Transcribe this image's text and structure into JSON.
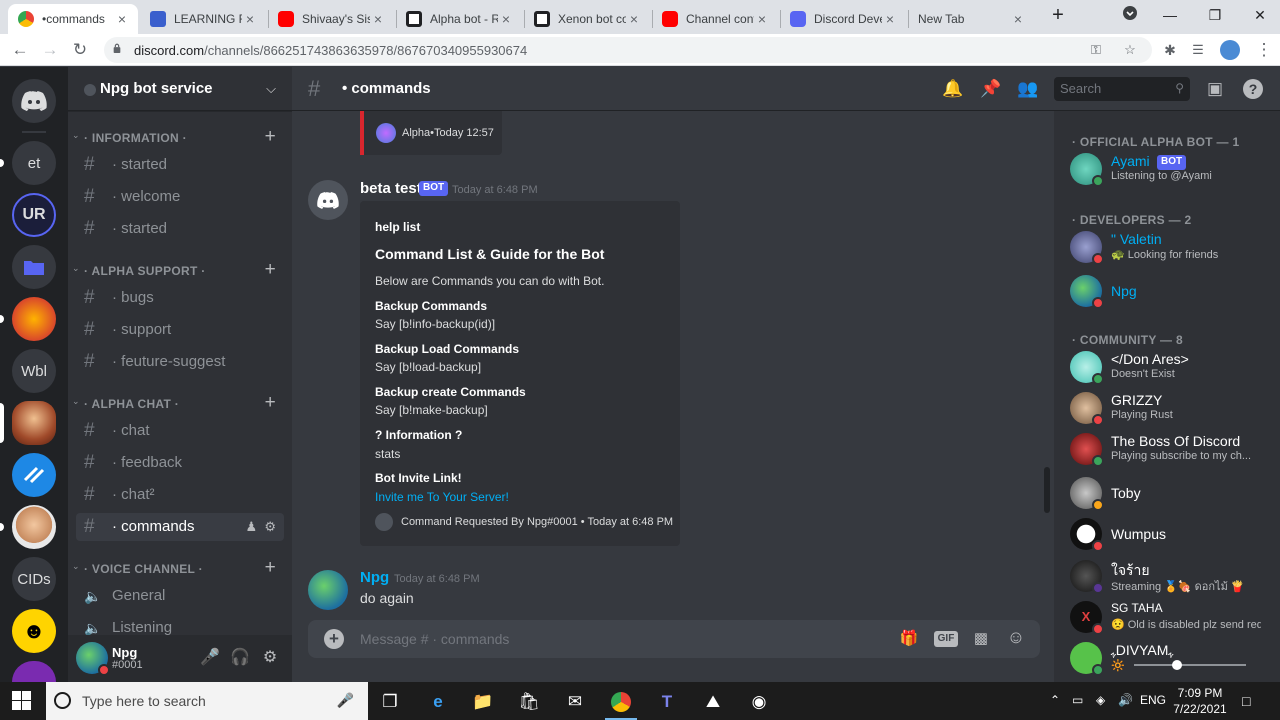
{
  "browser": {
    "tabs": [
      {
        "title": "•commands",
        "color": "#ea4335"
      },
      {
        "title": "LEARNING RE",
        "color": "#3a5fcd"
      },
      {
        "title": "Shivaay's Sist",
        "color": "#ff0000"
      },
      {
        "title": "Alpha bot - R",
        "color": "#202124"
      },
      {
        "title": "Xenon bot co",
        "color": "#202124"
      },
      {
        "title": "Channel cont",
        "color": "#ff0000"
      },
      {
        "title": "Discord Devel",
        "color": "#5865f2"
      },
      {
        "title": "New Tab",
        "color": ""
      }
    ],
    "url_domain": "discord.com",
    "url_path": "/channels/866251743863635978/867670340955930674",
    "new_tab_glyph": "+",
    "close_glyph": "×"
  },
  "guilds": [
    {
      "label": "",
      "icon": "discord-home-icon",
      "bg": "#36393f"
    },
    {
      "label": "et",
      "bg": "#36393f"
    },
    {
      "label": "",
      "icon": "server-logo-icon",
      "bg": "#1b1e3a"
    },
    {
      "label": "",
      "icon": "folder-icon",
      "bg": "#36393f"
    },
    {
      "label": "",
      "icon": "server-art-icon",
      "bg": "#d9472b"
    },
    {
      "label": "Wbl",
      "bg": "#36393f"
    },
    {
      "label": "",
      "icon": "server-avatar-icon",
      "bg": "#a04a2a"
    },
    {
      "label": "",
      "icon": "server-arrow-icon",
      "bg": "#1e88e5"
    },
    {
      "label": "",
      "icon": "server-face-icon",
      "bg": "#e8e8e8"
    },
    {
      "label": "CIDs",
      "bg": "#36393f"
    },
    {
      "label": "",
      "icon": "smiley-icon",
      "bg": "#ffd400"
    }
  ],
  "server": {
    "name": "Npg bot service"
  },
  "categories": [
    {
      "label": "· INFORMATION ·"
    },
    {
      "label": "· ALPHA SUPPORT ·"
    },
    {
      "label": "· ALPHA CHAT ·"
    },
    {
      "label": "· VOICE CHANNEL ·"
    }
  ],
  "channels": [
    {
      "label": "· started"
    },
    {
      "label": "· welcome"
    },
    {
      "label": "· started"
    },
    {
      "label": "· bugs"
    },
    {
      "label": "· support"
    },
    {
      "label": "· feuture-suggest"
    },
    {
      "label": "· chat"
    },
    {
      "label": "· feedback"
    },
    {
      "label": "· chat²"
    },
    {
      "label": "· commands"
    },
    {
      "label": "General"
    },
    {
      "label": "Listening"
    }
  ],
  "user": {
    "name": "Npg",
    "discriminator": "#0001"
  },
  "header": {
    "channel": "• commands",
    "search_placeholder": "Search"
  },
  "messages": {
    "prev_embed_footer": "Alpha•Today 12:57",
    "bot": {
      "author": "beta test",
      "tag": "BOT",
      "timestamp": "Today at 6:48 PM",
      "embed": {
        "author": "help list",
        "title": "Command List & Guide for the Bot",
        "description": "Below are Commands you can do with Bot.",
        "fields": [
          {
            "name": "Backup Commands",
            "value": "Say [b!info-backup(id)]"
          },
          {
            "name": "Backup Load Commands",
            "value": "Say [b!load-backup]"
          },
          {
            "name": "Backup create Commands",
            "value": "Say [b!make-backup]"
          },
          {
            "name": "? Information ?",
            "value": "stats"
          },
          {
            "name": "Bot Invite Link!",
            "value": "Invite me To Your Server!"
          }
        ],
        "footer": "Command Requested By Npg#0001 • Today at 6:48 PM"
      }
    },
    "user": {
      "author": "Npg",
      "timestamp": "Today at 6:48 PM",
      "text": "do again"
    }
  },
  "composer": {
    "placeholder": "Message # · commands",
    "gif_label": "GIF"
  },
  "members": {
    "groups": [
      {
        "label": "· OFFICIAL ALPHA BOT — 1"
      },
      {
        "label": "· DEVELOPERS — 2"
      },
      {
        "label": "· COMMUNITY — 8"
      }
    ],
    "list": [
      {
        "name": "Ayami",
        "status": "Listening to @Ayami",
        "bot": "BOT",
        "color": "#00aff4",
        "presence": "#3ba55c",
        "avatar": "#2a8c7a"
      },
      {
        "name": "\" Valetin",
        "status": "🐢 Looking for friends",
        "color": "#00aff4",
        "presence": "#ed4245",
        "avatar": "#3b3f6a"
      },
      {
        "name": "Npg",
        "status": "",
        "color": "#00aff4",
        "presence": "#ed4245",
        "avatar": "#1d6fa0"
      },
      {
        "name": "</Don Ares>",
        "status": "Doesn't Exist",
        "color": "#ffffff",
        "presence": "#3ba55c",
        "avatar": "#3fbfb0"
      },
      {
        "name": "GRIZZY",
        "status": "Playing Rust",
        "color": "#ffffff",
        "presence": "#ed4245",
        "avatar": "#b08a66"
      },
      {
        "name": "The Boss Of Discord",
        "status": "Playing subscribe to my ch...",
        "color": "#ffffff",
        "presence": "#3ba55c",
        "avatar": "#8a1a1a"
      },
      {
        "name": "Toby",
        "status": "",
        "color": "#ffffff",
        "presence": "#faa61a",
        "avatar": "#6c6c6c"
      },
      {
        "name": "Wumpus",
        "status": "",
        "color": "#ffffff",
        "presence": "#ed4245",
        "avatar": "#ffffff"
      },
      {
        "name": "ใจร้าย",
        "status": "Streaming 🏅🍖 ดอกไม้ 🍟",
        "color": "#ffffff",
        "presence": "#593695",
        "avatar": "#222222"
      },
      {
        "name": "SG TAHA",
        "status": "😟 Old is disabled plz send req...",
        "color": "#ffffff",
        "presence": "#ed4245",
        "avatar": "#111111"
      },
      {
        "name": "ﮩDIVYAMﮩ",
        "status": "🔆",
        "color": "#ffffff",
        "presence": "#3ba55c",
        "avatar": "#57c24a"
      }
    ]
  },
  "taskbar": {
    "search_placeholder": "Type here to search",
    "time": "7:09 PM",
    "date": "7/22/2021",
    "lang": "ENG"
  }
}
